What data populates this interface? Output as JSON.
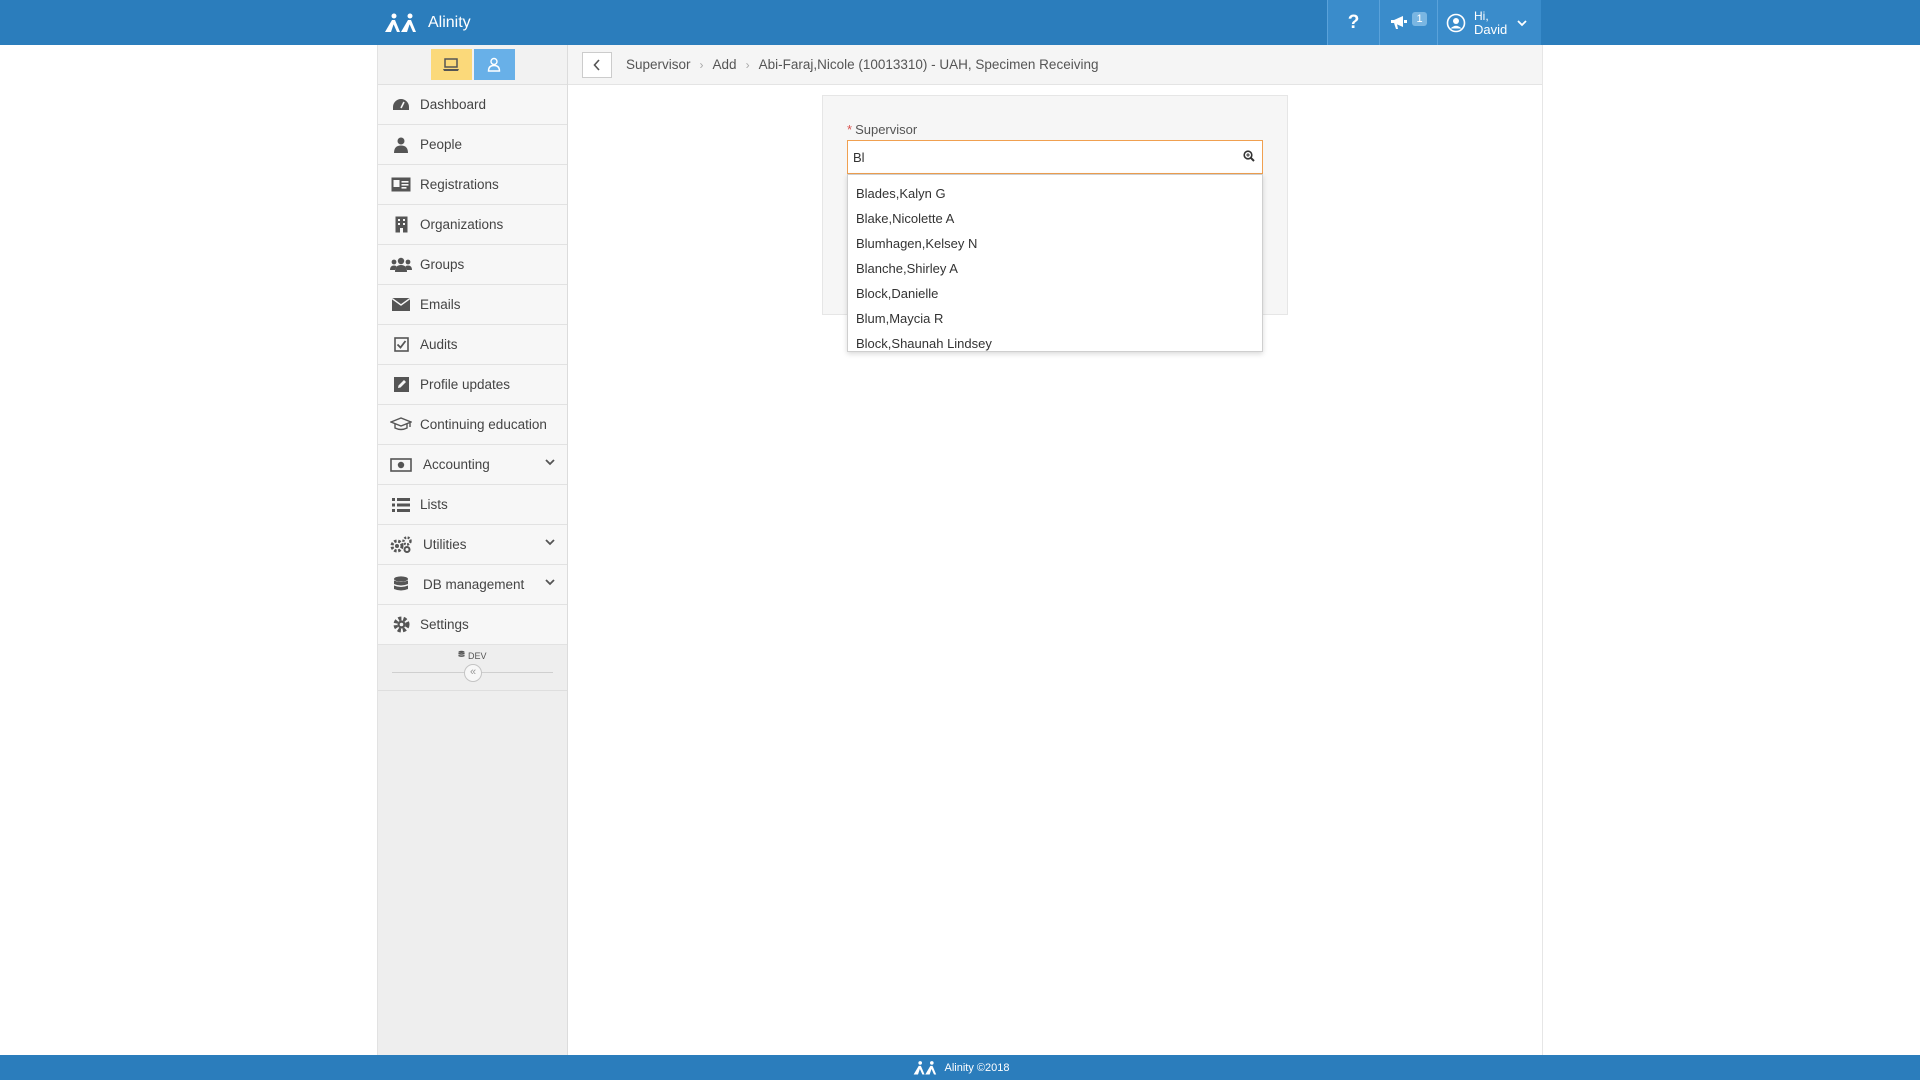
{
  "app": {
    "name": "Alinity",
    "footer_text": "Alinity ©2018"
  },
  "topbar": {
    "help_label": "?",
    "notification_count": "1",
    "greeting": "Hi,",
    "user_name": "David"
  },
  "sidebar": {
    "items": [
      {
        "label": "Dashboard",
        "icon": "dashboard-icon"
      },
      {
        "label": "People",
        "icon": "person-icon"
      },
      {
        "label": "Registrations",
        "icon": "id-card-icon"
      },
      {
        "label": "Organizations",
        "icon": "building-icon"
      },
      {
        "label": "Groups",
        "icon": "users-icon"
      },
      {
        "label": "Emails",
        "icon": "envelope-icon"
      },
      {
        "label": "Audits",
        "icon": "checkbox-icon"
      },
      {
        "label": "Profile updates",
        "icon": "edit-icon"
      },
      {
        "label": "Continuing education",
        "icon": "graduation-cap-icon"
      },
      {
        "label": "Accounting",
        "icon": "money-icon"
      },
      {
        "label": "Lists",
        "icon": "list-icon"
      },
      {
        "label": "Utilities",
        "icon": "cogs-icon"
      },
      {
        "label": "DB management",
        "icon": "database-icon"
      },
      {
        "label": "Settings",
        "icon": "gear-icon"
      }
    ],
    "env_label": "DEV",
    "collapse_label": "«"
  },
  "breadcrumb": {
    "items": [
      "Supervisor",
      "Add",
      "Abi-Faraj,Nicole (10013310) - UAH, Specimen Receiving"
    ],
    "separator": "›"
  },
  "form": {
    "required_mark": "*",
    "supervisor_label": "Supervisor",
    "search_value": "Bl",
    "suggestions": [
      "Blades,Kalyn G",
      "Blake,Nicolette A",
      "Blumhagen,Kelsey N",
      "Blanche,Shirley A",
      "Block,Danielle",
      "Blum,Maycia R",
      "Block,Shaunah Lindsey"
    ]
  },
  "colors": {
    "brand_blue": "#2b7dbc",
    "mode_yellow": "#fbd97a",
    "mode_blue": "#68b0e8",
    "focus_orange": "#f0a050",
    "required_red": "#d9534f"
  }
}
